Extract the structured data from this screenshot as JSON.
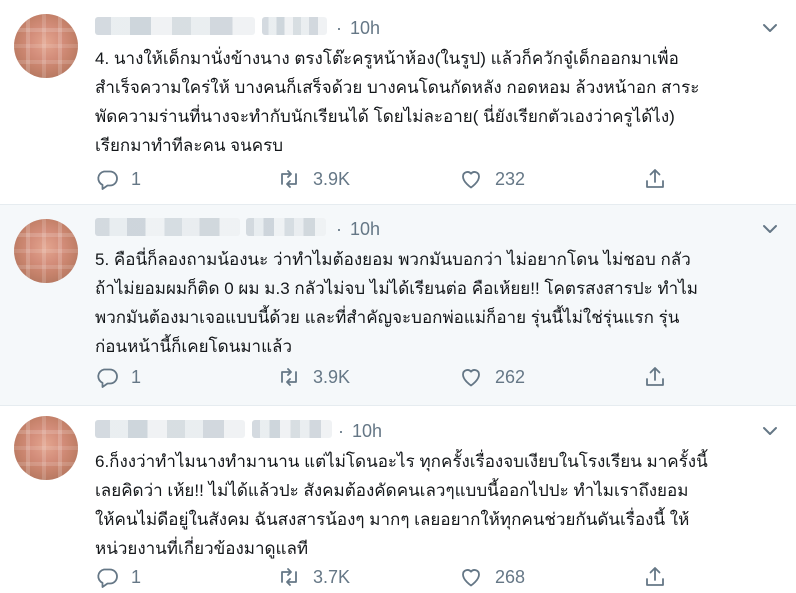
{
  "colors": {
    "text": "#14171a",
    "muted": "#657786",
    "highlight_background": "#f5f8fa",
    "divider": "#e6ecf0"
  },
  "tweets": [
    {
      "time": "10h",
      "lines": [
        "4. นางให้เด็กมานั่งข้างนาง ตรงโต๊ะครูหน้าห้อง(ในรูป) แล้วก็ควักจู๋เด็กออกมาเพื่อ",
        "สำเร็จความใคร่ให้ บางคนก็เสร็จด้วย บางคนโดนกัดหลัง กอดหอม ล้วงหน้าอก สาระ",
        "พัดความร่านที่นางจะทำกับนักเรียนได้ โดยไม่ละอาย( นี่ยังเรียกตัวเองว่าครูได้ไง)",
        "เรียกมาทำทีละคน จนครบ"
      ],
      "replies": "1",
      "retweets": "3.9K",
      "likes": "232"
    },
    {
      "time": "10h",
      "lines": [
        "5. คือนี่ก็ลองถามน้องนะ ว่าทำไมต้องยอม พวกมันบอกว่า ไม่อยากโดน ไม่ชอบ กลัว",
        "ถ้าไม่ยอมผมก็ติด 0 ผม ม.3 กลัวไม่จบ ไม่ได้เรียนต่อ คือเห้ยย!! โคตรสงสารปะ ทำไม",
        "พวกมันต้องมาเจอแบบนี้ด้วย และที่สำคัญจะบอกพ่อแม่ก็อาย รุ่นนี้ไม่ใช่รุ่นแรก รุ่น",
        "ก่อนหน้านี้ก็เคยโดนมาแล้ว"
      ],
      "replies": "1",
      "retweets": "3.9K",
      "likes": "262"
    },
    {
      "time": "10h",
      "lines": [
        "6.ก็งงว่าทำไมนางทำมานาน แต่ไม่โดนอะไร ทุกครั้งเรื่องจบเงียบในโรงเรียน มาครั้งนี้",
        "เลยคิดว่า เห้ย!! ไม่ได้แล้วปะ สังคมต้องคัดคนเลวๆแบบนี้ออกไปปะ ทำไมเราถึงยอม",
        "ให้คนไม่ดีอยู่ในสังคม ฉันสงสารน้องๆ มากๆ เลยอยากให้ทุกคนช่วยกันดันเรื่องนี้ ให้",
        "หน่วยงานที่เกี่ยวข้องมาดูแลที"
      ],
      "replies": "1",
      "retweets": "3.7K",
      "likes": "268"
    }
  ]
}
